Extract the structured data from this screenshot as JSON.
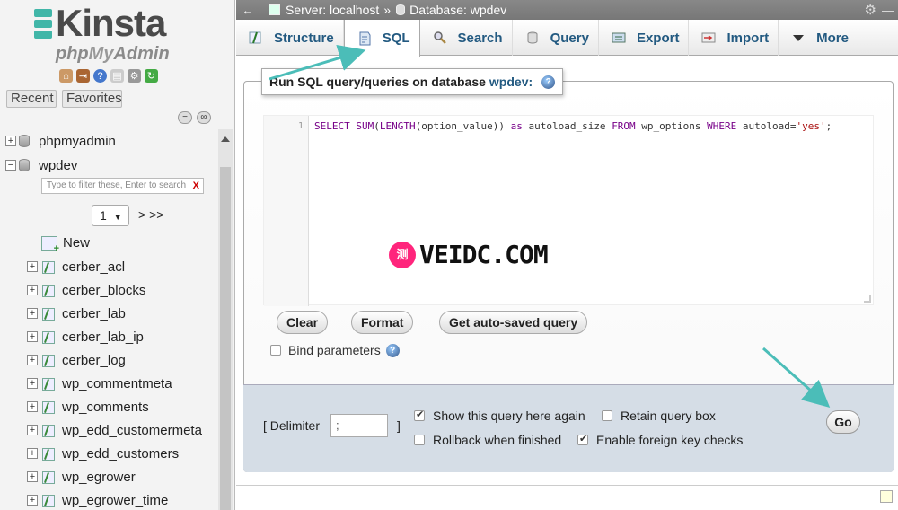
{
  "brand": {
    "name": "Kinsta",
    "sub_prefix": "php",
    "sub_my": "My",
    "sub_admin": "Admin"
  },
  "sidebar": {
    "recent_label": "Recent",
    "favorites_label": "Favorites",
    "filter_placeholder": "Type to filter these, Enter to search",
    "filter_clear": "X",
    "page_value": "1",
    "page_next": "> >>",
    "new_label": "New",
    "databases": [
      "phpmyadmin",
      "wpdev"
    ],
    "tables": [
      "cerber_acl",
      "cerber_blocks",
      "cerber_lab",
      "cerber_lab_ip",
      "cerber_log",
      "wp_commentmeta",
      "wp_comments",
      "wp_edd_customermeta",
      "wp_edd_customers",
      "wp_egrower",
      "wp_egrower_time"
    ]
  },
  "breadcrumb": {
    "server": "Server: localhost",
    "sep": "»",
    "database": "Database: wpdev"
  },
  "tabs": [
    {
      "label": "Structure",
      "icon": "structure-icon"
    },
    {
      "label": "SQL",
      "icon": "sql-icon"
    },
    {
      "label": "Search",
      "icon": "search-icon"
    },
    {
      "label": "Query",
      "icon": "query-icon"
    },
    {
      "label": "Export",
      "icon": "export-icon"
    },
    {
      "label": "Import",
      "icon": "import-icon"
    },
    {
      "label": "More",
      "icon": "chevron-down-icon"
    }
  ],
  "sql_panel": {
    "legend_prefix": "Run SQL query/queries on database",
    "legend_db": "wpdev:",
    "line_number": "1",
    "code": {
      "kw_select": "SELECT",
      "fn_sum": "SUM",
      "p1": "(",
      "fn_length": "LENGTH",
      "p2": "(option_value)) ",
      "kw_as": "as",
      "p3": " autoload_size ",
      "kw_from": "FROM",
      "p4": " wp_options ",
      "kw_where": "WHERE",
      "p5": " autoload=",
      "str": "'yes'",
      "p6": ";"
    },
    "clear_label": "Clear",
    "format_label": "Format",
    "autosaved_label": "Get auto-saved query",
    "bind_label": "Bind parameters"
  },
  "options": {
    "delimiter_label": "[ Delimiter",
    "delimiter_value": ";",
    "delimiter_close": "]",
    "show_query": "Show this query here again",
    "retain": "Retain query box",
    "rollback": "Rollback when finished",
    "foreign_key": "Enable foreign key checks",
    "go_label": "Go"
  },
  "watermark": {
    "badge": "测",
    "text": "VEIDC.COM"
  },
  "colors": {
    "accent": "#235a81",
    "arrow": "#4bbdb8",
    "kinsta": "#41b6a8"
  }
}
